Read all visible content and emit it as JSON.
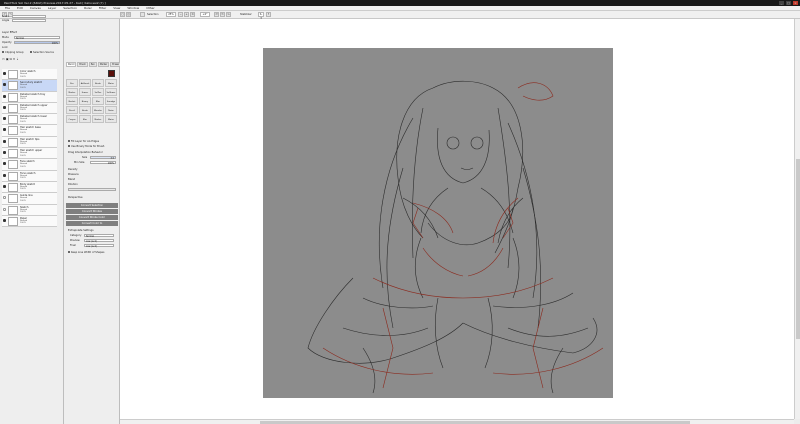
{
  "window": {
    "title": "PaintTool SAI Ver.2 (64bit) Preview.2017.05.27 - Kali [ Kaliv.sai2 (?) ]",
    "controls": [
      "_",
      "□",
      "×"
    ]
  },
  "menu": [
    "File",
    "Edit",
    "Canvas",
    "Layer",
    "Selection",
    "Ruler",
    "Filter",
    "View",
    "Window",
    "Other"
  ],
  "toolbar": {
    "selection_toggle": "Selection",
    "zoom": "25%",
    "angle": "+0°",
    "stabilizer": "Stabilizer",
    "stabilizer_value": "S-3"
  },
  "left": {
    "scale_label": "Scale",
    "angle_label": "Angle",
    "layer_effect": "Layer Effect",
    "mode_label": "Mode",
    "mode_value": "Normal",
    "opacity_label": "Opacity",
    "opacity_value": "100%",
    "lock_label": "Lock",
    "clipping_group": "Clipping Group",
    "selection_source": "Selection Source",
    "layers": [
      {
        "name": "Color sketch",
        "mode": "Normal",
        "opacity": "100%",
        "selected": false,
        "visible": true
      },
      {
        "name": "Secondary sketch",
        "mode": "Normal",
        "opacity": "100%",
        "selected": true,
        "visible": true
      },
      {
        "name": "Detailed sketch tray",
        "mode": "Normal",
        "opacity": "100%",
        "selected": false,
        "visible": true
      },
      {
        "name": "Detailed sketch upper",
        "mode": "Normal",
        "opacity": "100%",
        "selected": false,
        "visible": true
      },
      {
        "name": "Detailed sketch lower",
        "mode": "Normal",
        "opacity": "100%",
        "selected": false,
        "visible": true
      },
      {
        "name": "Hair sketch base",
        "mode": "Normal",
        "opacity": "100%",
        "selected": false,
        "visible": true
      },
      {
        "name": "Hair sketch tips",
        "mode": "Normal",
        "opacity": "100%",
        "selected": false,
        "visible": true
      },
      {
        "name": "Hair sketch upper",
        "mode": "Normal",
        "opacity": "100%",
        "selected": false,
        "visible": true
      },
      {
        "name": "Face sketch",
        "mode": "Normal",
        "opacity": "100%",
        "selected": false,
        "visible": true
      },
      {
        "name": "Torso sketch",
        "mode": "Normal",
        "opacity": "100%",
        "selected": false,
        "visible": true
      },
      {
        "name": "Body sketch",
        "mode": "Normal",
        "opacity": "100%",
        "selected": false,
        "visible": true
      },
      {
        "name": "Guide line",
        "mode": "Normal",
        "opacity": "100%",
        "selected": false,
        "visible": false
      },
      {
        "name": "Sketch",
        "mode": "Normal",
        "opacity": "100%",
        "selected": false,
        "visible": false
      },
      {
        "name": "Paper",
        "mode": "Normal",
        "opacity": "100%",
        "selected": false,
        "visible": true
      }
    ]
  },
  "tools": {
    "tabs": [
      "Pencil",
      "Brush",
      "Pen",
      "Marker",
      "Eraser"
    ],
    "grid": [
      "Pen",
      "AirBrush",
      "Brush",
      "Water",
      "Marker",
      "Eraser",
      "SelPen",
      "SelErase",
      "Bucket",
      "Binary",
      "Blur",
      "Smudge",
      "Pencil",
      "Brush",
      "Blender",
      "Noise",
      "Crayon",
      "Blur",
      "Marker",
      "Water"
    ],
    "options": {
      "use_layer_fill": "Fill Layer for AA Edges",
      "enable_outline": "Use Binary Mode for Brush",
      "drag_interpolation": "Drag Interpolation Behavior",
      "size_label": "Size",
      "size_value": "3.5",
      "min_size_label": "Min Size",
      "min_size_value": "100%",
      "density": "Density",
      "pressure": "Pressure",
      "blend": "Blend",
      "dilution": "Dilution",
      "persistence": "Persistence",
      "perspective_label": "Perspective",
      "buttons": [
        "Convert Selection",
        "Convert Strokes",
        "Convert Stroke Color",
        "Convert Color to"
      ],
      "extrapolate_label": "Extrapolate Settings",
      "category_label": "Category",
      "category_value": "Normal",
      "preview_label": "Preview",
      "preview_value": "Low (Lv.1)",
      "final_label": "Final",
      "final_value": "Low (Lv.1)",
      "keep_antialias": "Keep Line Width of Shapes"
    }
  },
  "colors": {
    "canvas": "#8c8c8c",
    "sketch_dark": "#2b2b2b",
    "sketch_red": "#8b2a1e",
    "selected_layer": "#c8d8f6",
    "primary_color": "#5a0f0a"
  }
}
